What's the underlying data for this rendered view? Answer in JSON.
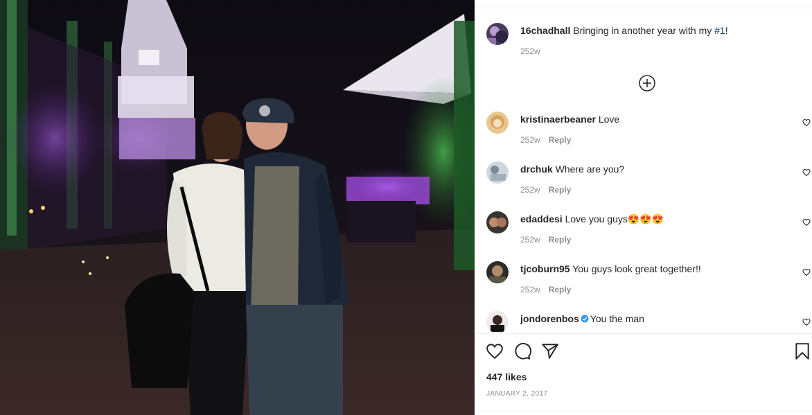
{
  "post": {
    "username": "16chadhall",
    "caption_prefix": "Bringing in another year with my ",
    "caption_hashtag": "#1",
    "caption_suffix": "!",
    "time": "252w"
  },
  "comments": [
    {
      "username": "kristinaerbeaner",
      "text": "Love",
      "time": "252w",
      "reply": "Reply"
    },
    {
      "username": "drchuk",
      "text": "Where are you?",
      "time": "252w",
      "reply": "Reply"
    },
    {
      "username": "edaddesi",
      "text": "Love you guys😍😍😍",
      "time": "252w",
      "reply": "Reply"
    },
    {
      "username": "tjcoburn95",
      "text": "You guys look great together!!",
      "time": "252w",
      "reply": "Reply"
    },
    {
      "username": "jondorenbos",
      "text": "You the man",
      "verified": true
    }
  ],
  "likes": "447 likes",
  "date": "JANUARY 2, 2017",
  "icons": {
    "load_more": "plus-circle-icon",
    "like": "heart-icon",
    "comment": "comment-bubble-icon",
    "share": "paper-plane-icon",
    "save": "bookmark-icon",
    "verified": "verified-badge-icon"
  },
  "colors": {
    "hashtag": "#00376b",
    "muted": "#8e8e8e",
    "verified": "#3897f0"
  }
}
